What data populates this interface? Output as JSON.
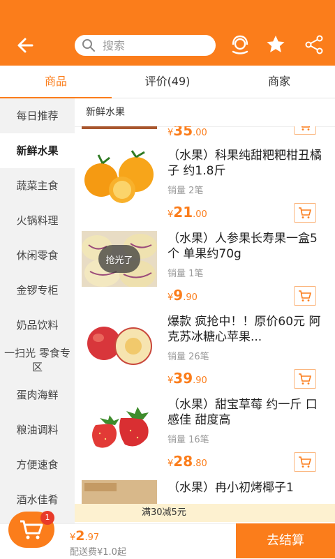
{
  "search": {
    "placeholder": "搜索"
  },
  "tabs": [
    {
      "label": "商品"
    },
    {
      "label": "评价(49)"
    },
    {
      "label": "商家"
    }
  ],
  "sidebar": {
    "items": [
      {
        "label": "每日推荐"
      },
      {
        "label": "新鲜水果"
      },
      {
        "label": "蔬菜主食"
      },
      {
        "label": "火锅料理"
      },
      {
        "label": "休闲零食"
      },
      {
        "label": "金锣专柜"
      },
      {
        "label": "奶品饮料"
      },
      {
        "label": "一扫光 零食专区"
      },
      {
        "label": "蛋肉海鲜"
      },
      {
        "label": "粮油调料"
      },
      {
        "label": "方便速食"
      },
      {
        "label": "酒水佳肴"
      }
    ]
  },
  "category_title": "新鲜水果",
  "partial_item": {
    "currency": "¥",
    "price_int": "35",
    "price_dec": ".00"
  },
  "products": [
    {
      "name": "（水果）科果纯甜粑粑柑丑橘子 约1.8斤",
      "sales": "销量 2笔",
      "currency": "¥",
      "price_int": "21",
      "price_dec": ".00",
      "badge": ""
    },
    {
      "name": "（水果）人参果长寿果一盒5个 单果约70g",
      "sales": "销量 1笔",
      "currency": "¥",
      "price_int": "9",
      "price_dec": ".90",
      "badge": "抢光了"
    },
    {
      "name": "爆款 疯抢中！！原价60元 阿克苏冰糖心苹果...",
      "sales": "销量 26笔",
      "currency": "¥",
      "price_int": "39",
      "price_dec": ".90",
      "badge": ""
    },
    {
      "name": "（水果）甜宝草莓 约一斤 口感佳 甜度高",
      "sales": "销量 16笔",
      "currency": "¥",
      "price_int": "28",
      "price_dec": ".80",
      "badge": ""
    },
    {
      "name": "（水果）冉小初烤椰子1",
      "sales": "",
      "currency": "",
      "price_int": "",
      "price_dec": "",
      "badge": ""
    }
  ],
  "promo": "满30减5元",
  "cart": {
    "badge_count": "1",
    "currency": "¥",
    "total_int": "2",
    "total_dec": ".97",
    "delivery": "配送费¥1.0起",
    "checkout_label": "去结算"
  },
  "colors": {
    "accent": "#fb7d1b",
    "badge": "#e83b2a",
    "promo_bg": "#fdf1d0"
  },
  "icons": [
    "back-arrow-icon",
    "search-icon",
    "customer-service-icon",
    "star-icon",
    "share-icon",
    "cart-icon"
  ]
}
